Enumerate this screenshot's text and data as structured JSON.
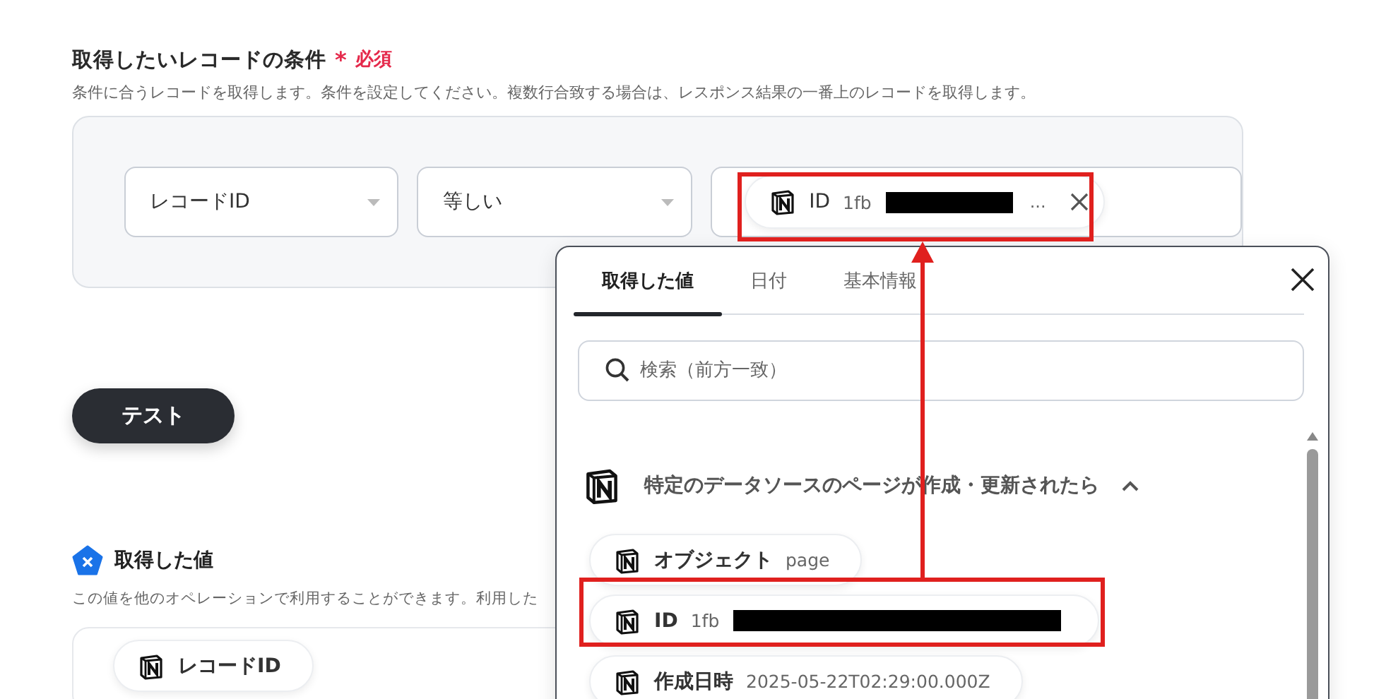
{
  "condition": {
    "title": "取得したいレコードの条件",
    "required_mark": "*",
    "required": "必須",
    "description": "条件に合うレコードを取得します。条件を設定してください。複数行合致する場合は、レスポンス結果の一番上のレコードを取得します。",
    "selects": [
      {
        "value": "レコードID"
      },
      {
        "value": "等しい"
      }
    ],
    "value_chip": {
      "label": "ID",
      "value": "1fb",
      "redacted": true,
      "ellipsis": "..."
    }
  },
  "test_button": "テスト",
  "output": {
    "title": "取得した値",
    "description": "この値を他のオペレーションで利用することができます。利用した",
    "chips": [
      {
        "label": "レコードID"
      }
    ]
  },
  "panel": {
    "tabs": [
      {
        "label": "取得した値",
        "selected": true
      },
      {
        "label": "日付",
        "selected": false
      },
      {
        "label": "基本情報",
        "selected": false
      }
    ],
    "search": {
      "placeholder": "検索（前方一致）"
    },
    "group": {
      "title": "特定のデータソースのページが作成・更新されたら",
      "expanded": true,
      "items": [
        {
          "label": "オブジェクト",
          "value": "page",
          "redacted": false
        },
        {
          "label": "ID",
          "value": "1fb",
          "redacted": true
        },
        {
          "label": "作成日時",
          "value": "2025-05-22T02:29:00.000Z",
          "redacted": false
        }
      ]
    }
  }
}
